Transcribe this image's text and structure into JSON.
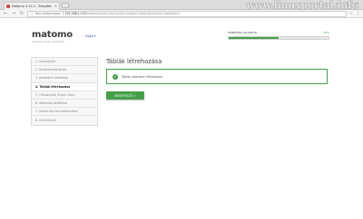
{
  "browser": {
    "tab_title": "Matomo 3.11.0 - Telepítés",
    "tab_close": "×",
    "security": "Nem biztonságos",
    "url_host": "192.168.1.123",
    "url_path": "/matomo/index.php?action=tablesCreation&module=Installation",
    "window_controls": [
      "–",
      "▢",
      "✕"
    ]
  },
  "watermark": "www.linuxportal.info",
  "header": {
    "logo": "matomo",
    "tagline": "formerly Piwik Analytics",
    "help": "Súgó ▾",
    "progress_label": "TELEPÍTÉS ÁLLAPOTA",
    "progress_percent_text": "50%",
    "progress_fraction": 0.5
  },
  "sidebar": {
    "steps": [
      "1. Üdvözöljük!",
      "2. Rendszerellenőrzés",
      "3. Adatbázis beállítása",
      "4. Táblák létrehozása",
      "5. Felhasználó (Super User)",
      "6. Weboldal beállítása",
      "7. JavaScript kód beillesztése",
      "8. Gratulálunk"
    ],
    "active_index": 3
  },
  "main": {
    "title": "Táblák létrehozása",
    "success_message": "Táblák sikeresen létrehozva!",
    "next_button": "Következő »"
  },
  "colors": {
    "accent_green": "#43a047",
    "link_blue": "#3450a3"
  }
}
